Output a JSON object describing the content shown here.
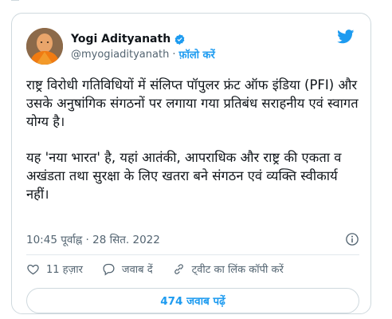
{
  "tweet": {
    "author": {
      "display_name": "Yogi Adityanath",
      "handle": "@myogiadityanath",
      "separator": "·",
      "follow_label": "फ़ॉलो करें",
      "verified": true
    },
    "paragraphs": [
      "राष्ट्र विरोधी गतिविधियों में संलिप्त पॉपुलर फ्रंट ऑफ इंडिया (PFI) और उसके अनुषांगिक संगठनों पर लगाया गया प्रतिबंध सराहनीय एवं स्वागत योग्य है।",
      "यह 'नया भारत' है, यहां आतंकी, आपराधिक और राष्ट्र की एकता व अखंडता तथा सुरक्षा के लिए खतरा बने संगठन एवं व्यक्ति स्वीकार्य नहीं।"
    ],
    "timestamp": "10:45 पूर्वाह्न · 28 सित. 2022",
    "actions": {
      "likes": "11 हज़ार",
      "reply": "जवाब दें",
      "copy_link": "ट्वीट का लिंक कॉपी करें"
    },
    "replies_button": "474 जवाब पढ़ें"
  },
  "colors": {
    "accent": "#1d9bf0",
    "text": "#0f1419",
    "muted": "#536471",
    "border": "#cfd9de"
  },
  "icons": [
    "verified-badge-icon",
    "twitter-bird-icon",
    "info-icon",
    "heart-icon",
    "reply-bubble-icon",
    "link-icon"
  ]
}
